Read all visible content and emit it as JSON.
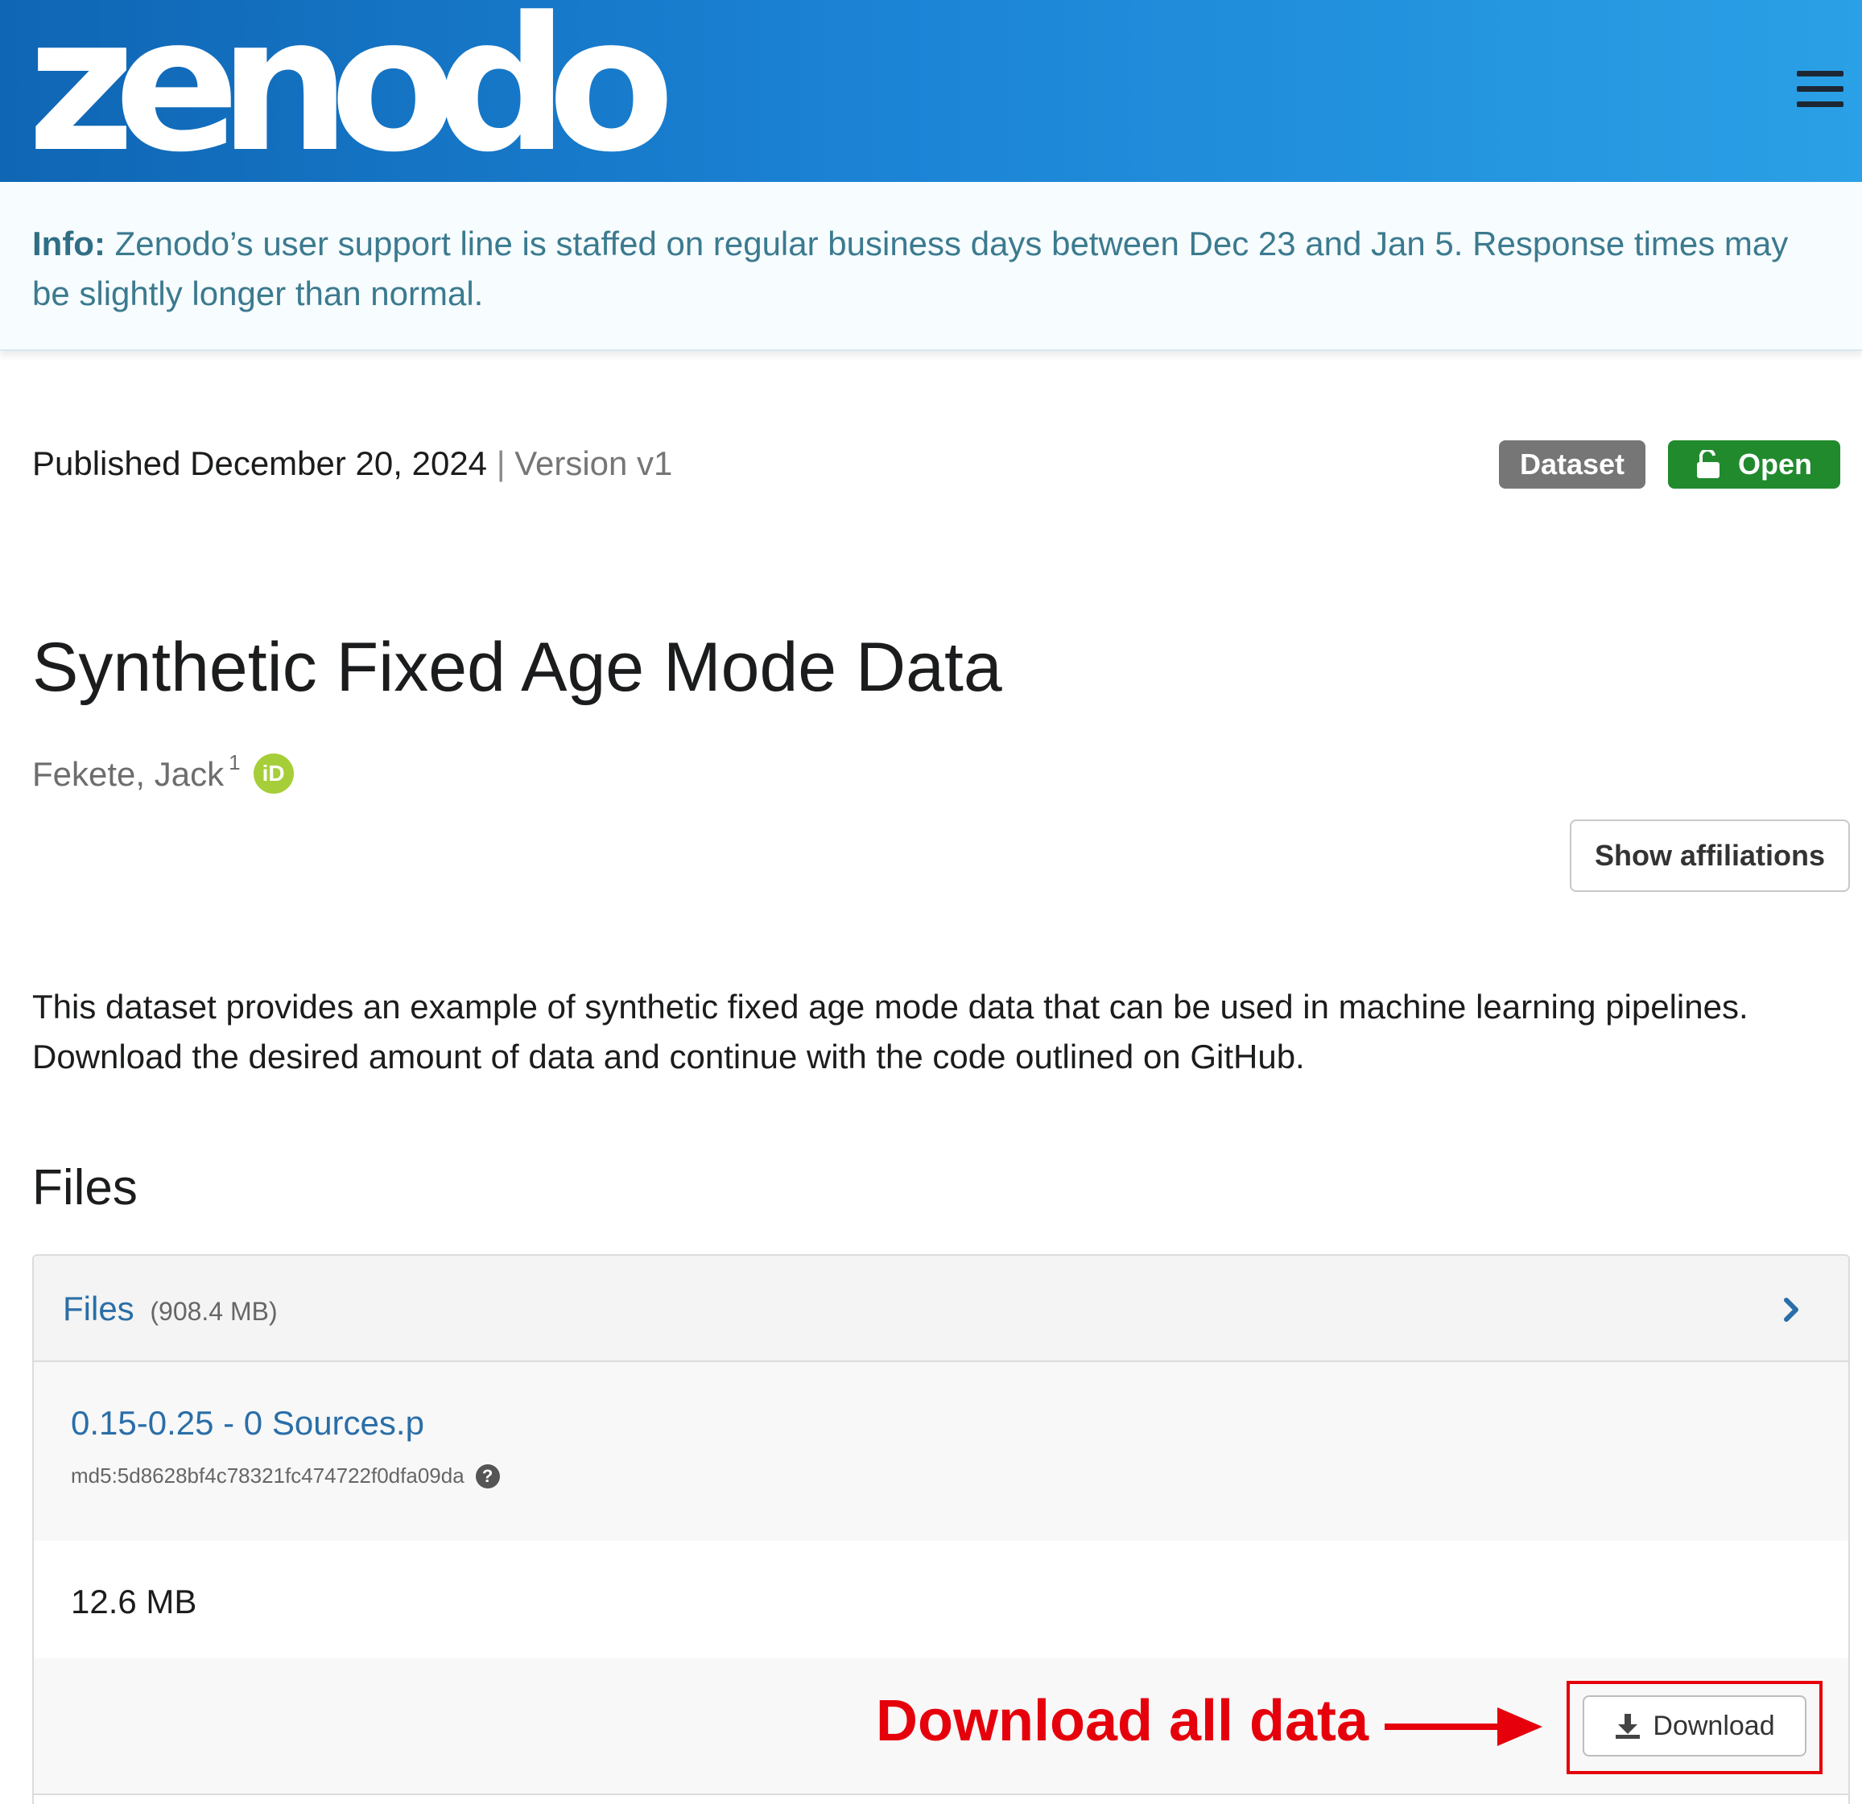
{
  "header": {
    "logo_text": "zenodo",
    "menu_icon": "hamburger-menu-icon",
    "gradient_from": "#0f66b4",
    "gradient_to": "#2aa0e6"
  },
  "info_banner": {
    "label": "Info:",
    "message": "Zenodo’s user support line is staffed on regular business days between Dec 23 and Jan 5. Response times may be slightly longer than normal."
  },
  "record": {
    "published": "Published December 20, 2024",
    "separator": "|",
    "version": "Version v1",
    "badges": {
      "type": "Dataset",
      "access": "Open"
    },
    "title": "Synthetic Fixed Age Mode Data",
    "author": "Fekete, Jack",
    "author_affiliation_ref": "1",
    "orcid_icon": "orcid-icon",
    "show_affiliations_label": "Show affiliations",
    "description": "This dataset provides an example of synthetic fixed age mode data that can be used in machine learning pipelines. Download the desired amount of data and continue with the code outlined on GitHub."
  },
  "files": {
    "heading": "Files",
    "panel_label": "Files",
    "total_size": "(908.4 MB)",
    "items": [
      {
        "name": "0.15-0.25 - 0 Sources.p",
        "md5": "md5:5d8628bf4c78321fc474722f0dfa09da",
        "size": "12.6 MB",
        "download_label": "Download"
      }
    ]
  },
  "annotation": {
    "text": "Download all data",
    "color": "#e5000b"
  },
  "colors": {
    "link": "#2a6ea8",
    "open_badge": "#218a2d",
    "dataset_badge": "#767676",
    "info_text": "#3b7a8f"
  }
}
